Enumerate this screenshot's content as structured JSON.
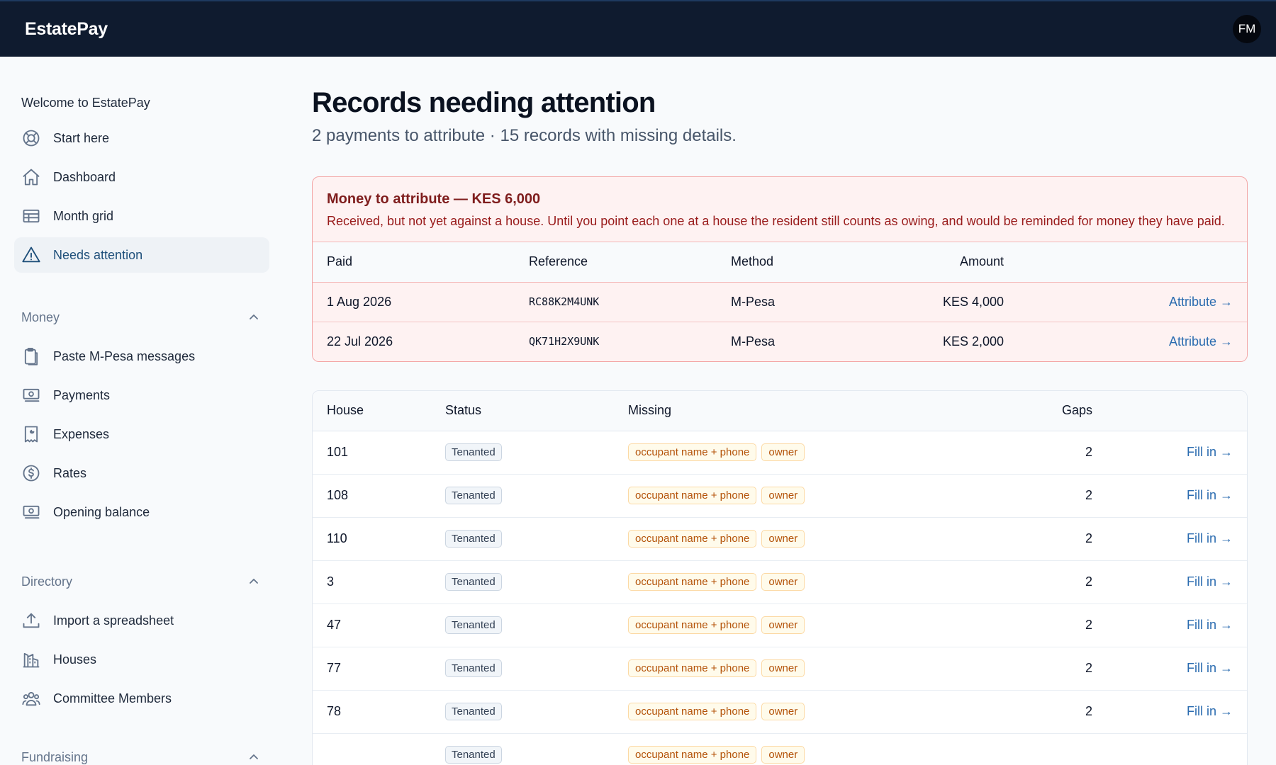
{
  "app": {
    "brand": "EstatePay",
    "user_initials": "FM"
  },
  "sidebar": {
    "welcome": "Welcome to EstatePay",
    "items": [
      {
        "label": "Start here",
        "icon": "lifebuoy-icon"
      },
      {
        "label": "Dashboard",
        "icon": "home-icon"
      },
      {
        "label": "Month grid",
        "icon": "table-icon"
      },
      {
        "label": "Needs attention",
        "icon": "warning-icon",
        "active": true
      }
    ],
    "money": {
      "label": "Money",
      "items": [
        {
          "label": "Paste M-Pesa messages",
          "icon": "clipboard-icon"
        },
        {
          "label": "Payments",
          "icon": "banknote-icon"
        },
        {
          "label": "Expenses",
          "icon": "receipt-icon"
        },
        {
          "label": "Rates",
          "icon": "dollar-icon"
        },
        {
          "label": "Opening balance",
          "icon": "banknote-icon"
        }
      ]
    },
    "directory": {
      "label": "Directory",
      "items": [
        {
          "label": "Import a spreadsheet",
          "icon": "upload-icon"
        },
        {
          "label": "Houses",
          "icon": "building-icon"
        },
        {
          "label": "Committee Members",
          "icon": "users-icon"
        }
      ]
    },
    "fundraising": {
      "label": "Fundraising"
    }
  },
  "main": {
    "title": "Records needing attention",
    "subtitle": "2 payments to attribute · 15 records with missing details."
  },
  "attribute": {
    "title": "Money to attribute — KES 6,000",
    "description": "Received, but not yet against a house. Until you point each one at a house the resident still counts as owing, and would be reminded for money they have paid.",
    "columns": {
      "paid": "Paid",
      "reference": "Reference",
      "method": "Method",
      "amount": "Amount"
    },
    "rows": [
      {
        "paid": "1 Aug 2026",
        "reference": "RC88K2M4UNK",
        "method": "M-Pesa",
        "amount": "KES 4,000",
        "action": "Attribute →"
      },
      {
        "paid": "22 Jul 2026",
        "reference": "QK71H2X9UNK",
        "method": "M-Pesa",
        "amount": "KES 2,000",
        "action": "Attribute →"
      }
    ]
  },
  "records": {
    "columns": {
      "house": "House",
      "status": "Status",
      "missing": "Missing",
      "gaps": "Gaps"
    },
    "rows": [
      {
        "house": "101",
        "status": "Tenanted",
        "missing": [
          "occupant name + phone",
          "owner"
        ],
        "gaps": "2",
        "action": "Fill in →"
      },
      {
        "house": "108",
        "status": "Tenanted",
        "missing": [
          "occupant name + phone",
          "owner"
        ],
        "gaps": "2",
        "action": "Fill in →"
      },
      {
        "house": "110",
        "status": "Tenanted",
        "missing": [
          "occupant name + phone",
          "owner"
        ],
        "gaps": "2",
        "action": "Fill in →"
      },
      {
        "house": "3",
        "status": "Tenanted",
        "missing": [
          "occupant name + phone",
          "owner"
        ],
        "gaps": "2",
        "action": "Fill in →"
      },
      {
        "house": "47",
        "status": "Tenanted",
        "missing": [
          "occupant name + phone",
          "owner"
        ],
        "gaps": "2",
        "action": "Fill in →"
      },
      {
        "house": "77",
        "status": "Tenanted",
        "missing": [
          "occupant name + phone",
          "owner"
        ],
        "gaps": "2",
        "action": "Fill in →"
      },
      {
        "house": "78",
        "status": "Tenanted",
        "missing": [
          "occupant name + phone",
          "owner"
        ],
        "gaps": "2",
        "action": "Fill in →"
      },
      {
        "house": "",
        "status": "Tenanted",
        "missing": [
          "occupant name + phone",
          "owner"
        ],
        "gaps": "",
        "action": ""
      }
    ]
  },
  "colors": {
    "topbar": "#0f1b2f",
    "accent": "#2b6cb0",
    "alert_bg": "#fef2f2",
    "alert_border": "#f3a5a5",
    "alert_title": "#7f1d1d",
    "missing_text": "#b45309",
    "missing_bg": "#fffbeb"
  }
}
